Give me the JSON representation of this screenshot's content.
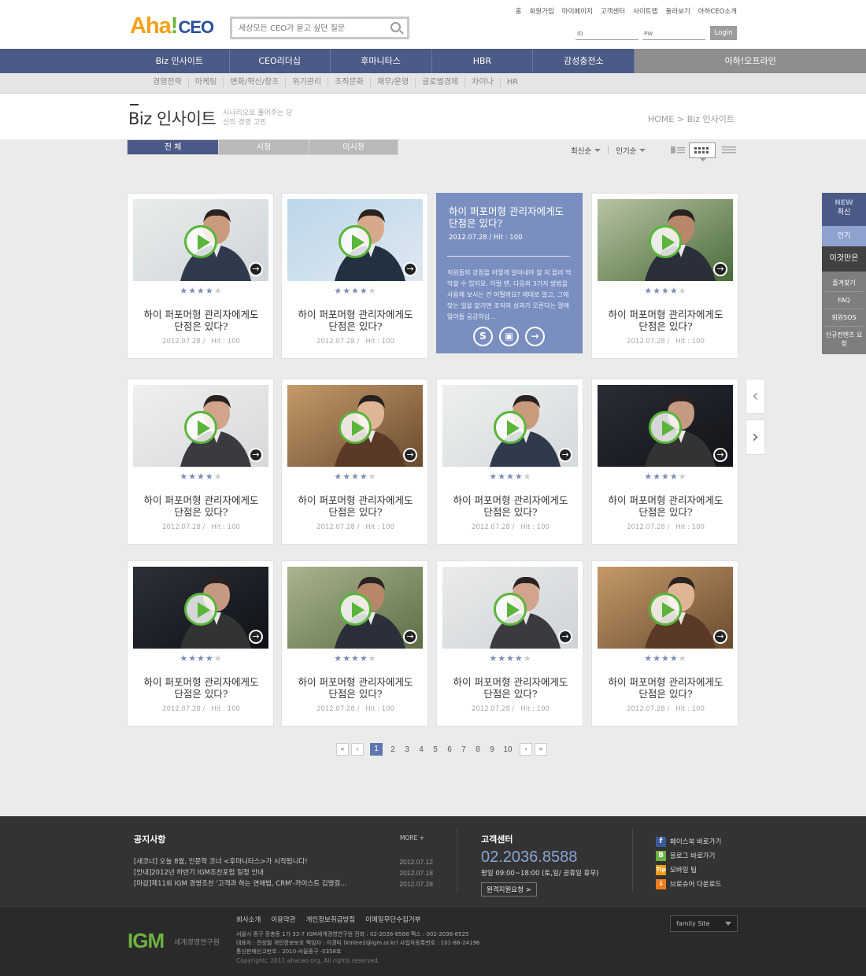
{
  "header": {
    "logo": {
      "a": "Aha",
      "ex": "!",
      "ceo": "CEO"
    },
    "search_placeholder": "세상모든 CEO가 묻고 싶던 질문",
    "util": [
      "홈",
      "회원가입",
      "마이페이지",
      "고객센터",
      "사이트맵",
      "둘러보기",
      "아하CEO소개"
    ],
    "id_label": "ID",
    "pw_label": "PW",
    "login": "Login"
  },
  "gnb": [
    "Biz 인사이트",
    "CEO리더십",
    "후마니타스",
    "HBR",
    "감성충전소",
    "아하!오프라인"
  ],
  "lnb": [
    "경영전략",
    "마케팅",
    "변화/혁신/창조",
    "위기관리",
    "조직문화",
    "재무/운영",
    "글로벌경제",
    "차이나",
    "HR"
  ],
  "page": {
    "title": "Biz 인사이트",
    "subtitle": "시나리오로 풀어주는 당신의 경영 고민",
    "breadcrumb": "HOME > Biz 인사이트"
  },
  "tabs": [
    "전 체",
    "시청",
    "미시청"
  ],
  "sort": [
    "최신순",
    "인기순"
  ],
  "card": {
    "title": "하이 퍼포머형 관리자에게도 단점은 있다?",
    "date": "2012.07.28 /",
    "hit": "Hit : 100",
    "rating": 4,
    "max_rating": 5
  },
  "hover_card": {
    "title": "하이 퍼포머형 관리자에게도 단점은 있다?",
    "meta": "2012.07.28 /   Hit : 100",
    "desc": "직원들의 강점을 어떻게 알아내야 할 지 몰라 막막할 수 있지요. 이럴 땐, 다음의 3가지 방법을 사용해 보시는 건 어떨까요? 제대로 알고, 그에 맞는 일을 맡기면 조직의 성과가 오른다는 말에 많이들 공감하십..."
  },
  "quick": {
    "new": "NEW",
    "latest": "최신",
    "popular": "인기",
    "must": "이것만은",
    "items": [
      "즐겨찾기",
      "FAQ",
      "회원SOS",
      "신규컨텐츠 요청"
    ]
  },
  "pager": {
    "pages": [
      "1",
      "2",
      "3",
      "4",
      "5",
      "6",
      "7",
      "8",
      "9",
      "10"
    ],
    "current": "1"
  },
  "footer": {
    "notice_title": "공지사항",
    "more": "MORE +",
    "notices": [
      {
        "text": "[새코너] 오늘 8월, 인문학 코너 <후마니타스>가 시작됩니다!",
        "date": "2012.07.12"
      },
      {
        "text": "[안내]2012년 하반기 IGM조찬포럼 일정 안내",
        "date": "2012.07.18"
      },
      {
        "text": "[마감]제11회 IGM 경영조찬 '고객과 하는 연애법, CRM'-카이스트 김영걸...",
        "date": "2012.07.28"
      }
    ],
    "cs_title": "고객센터",
    "tel": "02.2036.8588",
    "hours": "평일 09:00~18:00 (토,일/ 공휴일 휴무)",
    "remote": "원격지원요청 >",
    "social": [
      "페이스북 바로가기",
      "블로그 바로가기",
      "모바일 팁",
      "브로슈어 다운로드"
    ],
    "links": [
      "회사소개",
      "이용약관",
      "개인정보취급방침",
      "이메일무단수집거부"
    ],
    "igm": "IGM",
    "igm_name": "세계경영연구원",
    "addr1": "서울시 중구 장충동 1가 33-7 IGM세계경영연구원  전화 : 02-2036-8588  팩스 : 002-2036-8525",
    "addr2": "대표자 : 전성철  개인정보보호 책임자 : 이경미 (kmlee2@igm.or.kr)  사업자등록번호 : 101-86-24196",
    "addr3": "통신판매신고번호 : 2010-서울중구 -0358호",
    "copyright": "Copyrightc 2011 ahaceo.org. All rights reserved.",
    "family": "family Site"
  },
  "colors": {
    "navy": "#4b5a86",
    "green": "#5ab53a",
    "hover": "#7a8fbf"
  }
}
